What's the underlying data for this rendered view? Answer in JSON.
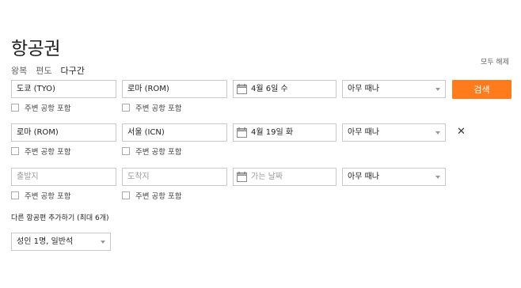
{
  "page": {
    "title": "항공권"
  },
  "trip_types": [
    "왕복",
    "편도",
    "다구간"
  ],
  "clear_all_label": "모두 해제",
  "search_button_label": "검색",
  "flight1": {
    "origin": "도쿄 (TYO)",
    "destination": "로마 (ROM)",
    "date": "4월 6일 수",
    "time": "아무 때나",
    "origin_nearby": "주변 공항 포함",
    "destination_nearby": "주변 공항 포함"
  },
  "flight2": {
    "origin": "로마 (ROM)",
    "destination": "서울 (ICN)",
    "date": "4월 19일 화",
    "time": "아무 때나",
    "origin_nearby": "주변 공항 포함",
    "destination_nearby": "주변 공항 포함",
    "remove_label": "✕"
  },
  "flight3": {
    "origin_placeholder": "출발지",
    "destination_placeholder": "도착지",
    "date_placeholder": "가는 날짜",
    "time": "아무 때나",
    "origin_nearby": "주변 공항 포함",
    "destination_nearby": "주변 공항 포함"
  },
  "add_flight_label": "다른 항공편 추가하기 (최대 6개)",
  "travelers_label": "성인 1명, 일반석",
  "colors": {
    "accent": "#ff7b1c",
    "border": "#c9c9c9"
  }
}
